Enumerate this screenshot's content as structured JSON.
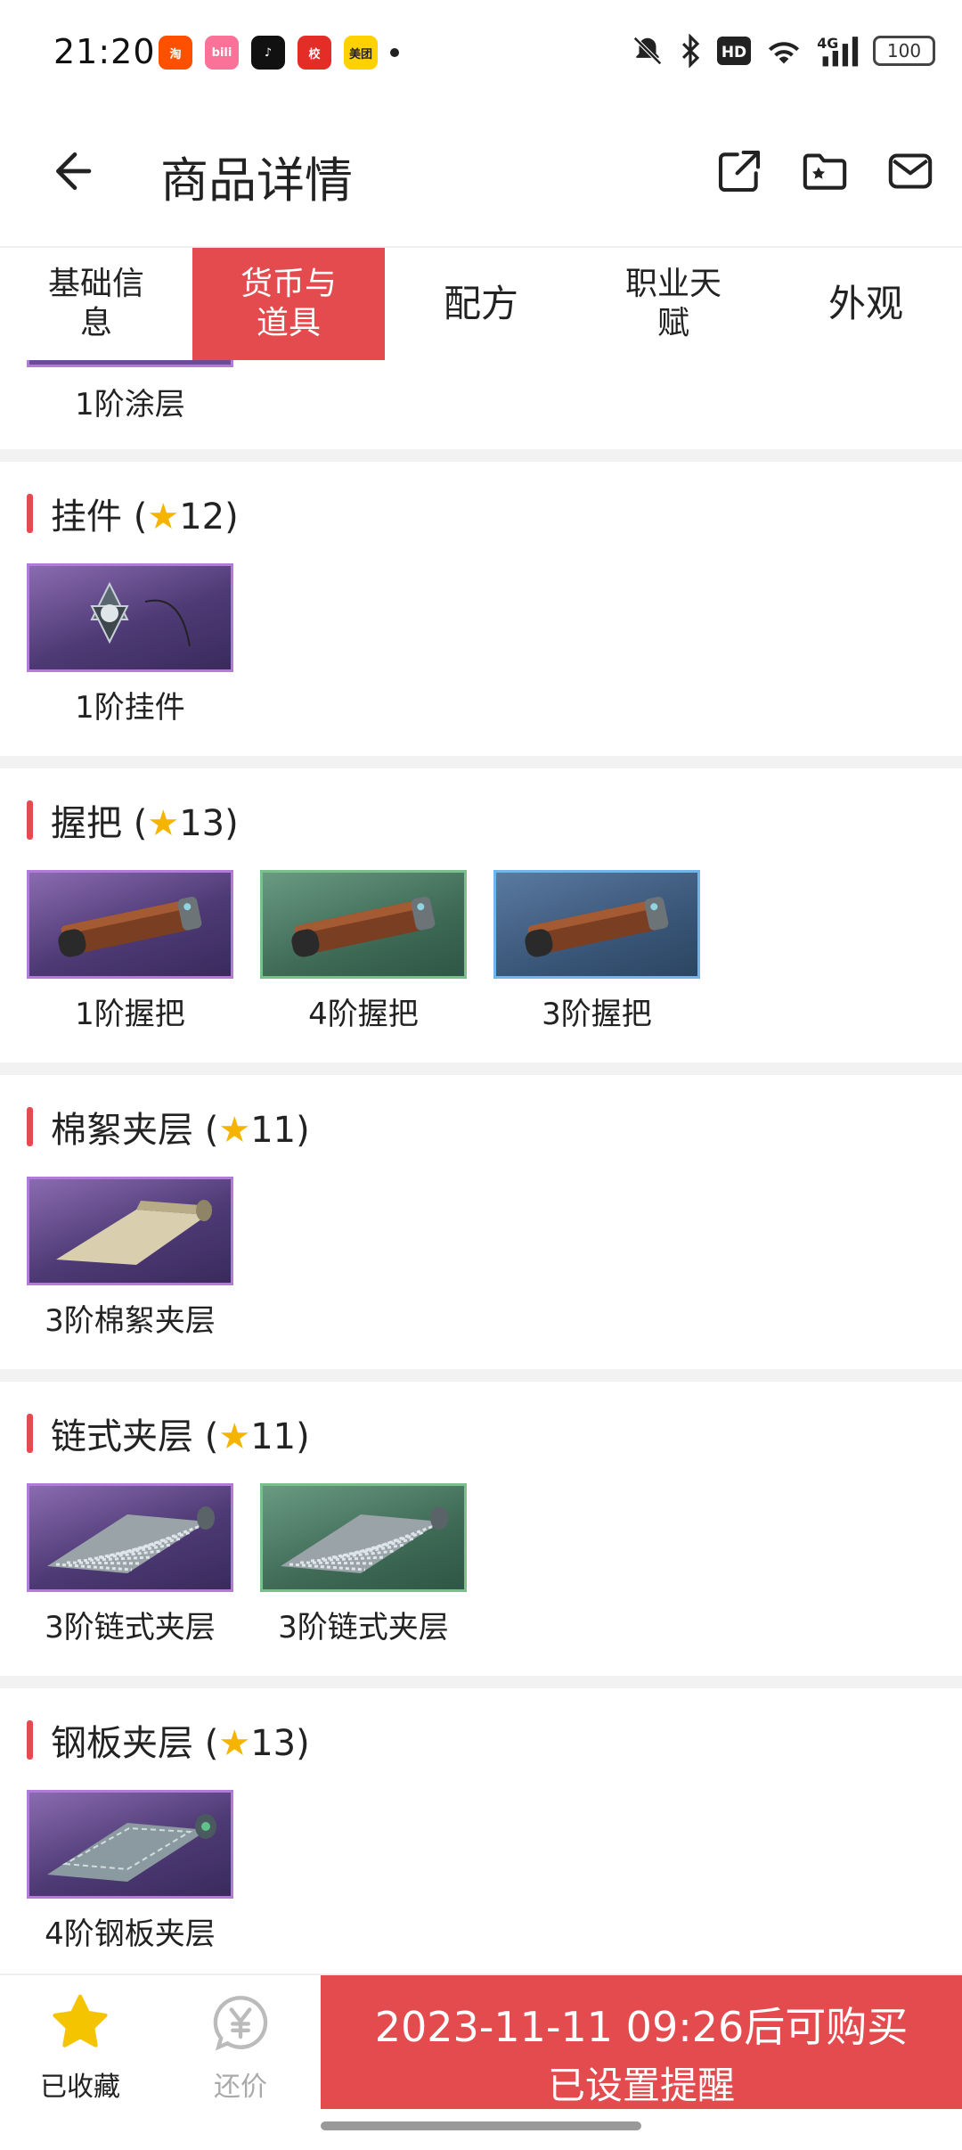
{
  "status": {
    "time": "21:20",
    "apps": [
      {
        "name": "taobao-icon",
        "text": "淘",
        "color": "#ff5000"
      },
      {
        "name": "bilibili-icon",
        "text": "bili",
        "color": "#fb7299"
      },
      {
        "name": "tiktok-icon",
        "text": "♪",
        "color": "#111111"
      },
      {
        "name": "app-red-icon",
        "text": "校",
        "color": "#e52d27"
      },
      {
        "name": "meituan-icon",
        "text": "美团",
        "color": "#ffd100"
      }
    ],
    "battery": "100"
  },
  "header": {
    "title": "商品详情"
  },
  "tabs": [
    {
      "label": "基础信\n息",
      "active": false
    },
    {
      "label": "货币与\n道具",
      "active": true
    },
    {
      "label": "配方",
      "active": false
    },
    {
      "label": "职业天\n赋",
      "active": false
    },
    {
      "label": "外观",
      "active": false
    }
  ],
  "partial_item": {
    "label": "1阶涂层"
  },
  "sections": [
    {
      "title": "挂件",
      "star": "★",
      "level": "12",
      "items": [
        {
          "label": "1阶挂件",
          "tier": "purple",
          "shape": "pendant"
        }
      ]
    },
    {
      "title": "握把",
      "star": "★",
      "level": "13",
      "items": [
        {
          "label": "1阶握把",
          "tier": "purple",
          "shape": "grip"
        },
        {
          "label": "4阶握把",
          "tier": "green",
          "shape": "grip"
        },
        {
          "label": "3阶握把",
          "tier": "blue",
          "shape": "grip"
        }
      ]
    },
    {
      "title": "棉絮夹层",
      "star": "★",
      "level": "11",
      "items": [
        {
          "label": "3阶棉絮夹层",
          "tier": "purple",
          "shape": "cloth"
        }
      ]
    },
    {
      "title": "链式夹层",
      "star": "★",
      "level": "11",
      "items": [
        {
          "label": "3阶链式夹层",
          "tier": "purple",
          "shape": "chain"
        },
        {
          "label": "3阶链式夹层",
          "tier": "green",
          "shape": "chain"
        }
      ]
    },
    {
      "title": "钢板夹层",
      "star": "★",
      "level": "13",
      "items": [
        {
          "label": "4阶钢板夹层",
          "tier": "purple",
          "shape": "plate"
        }
      ]
    }
  ],
  "bottom": {
    "favorite_label": "已收藏",
    "bargain_label": "还价",
    "buy_line1": "2023-11-11 09:26后可购买",
    "buy_line2": "已设置提醒"
  },
  "colors": {
    "accent": "#e44b4f",
    "star": "#f5b400"
  }
}
